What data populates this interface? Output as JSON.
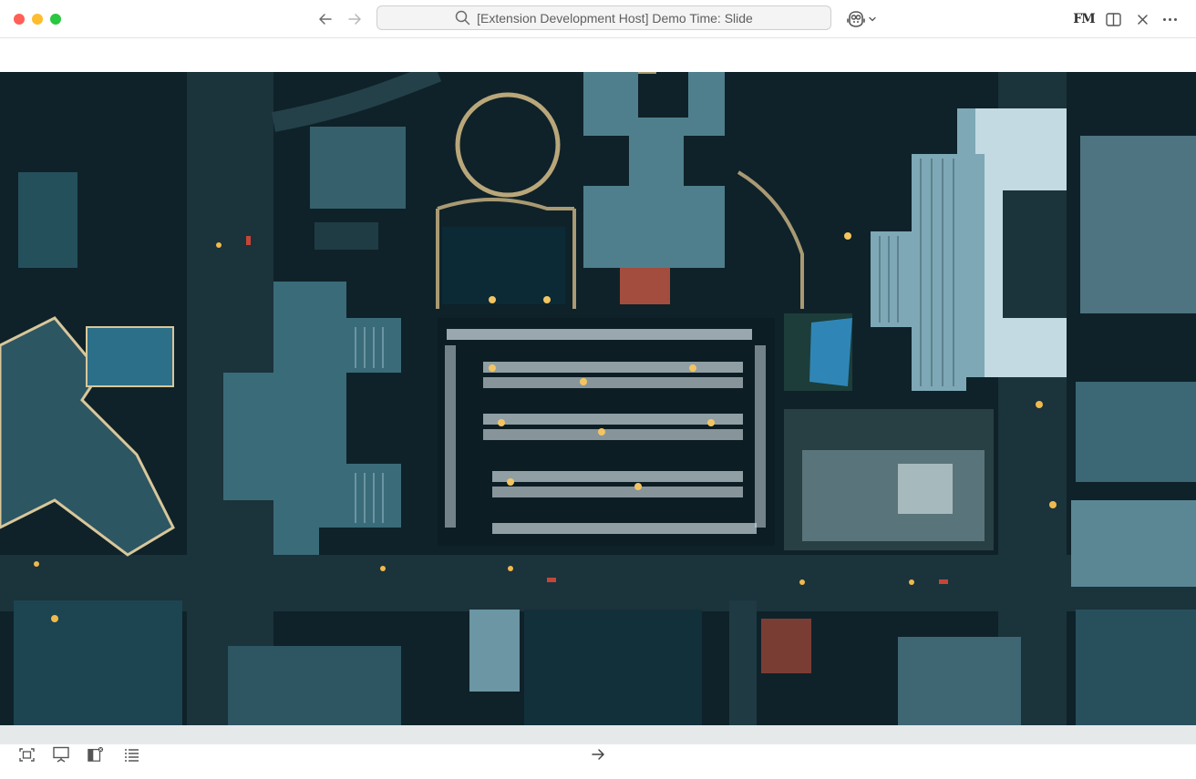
{
  "window": {
    "title": "[Extension Development Host] Demo Time: Slide"
  },
  "titlebar": {
    "traffic_lights": [
      "close",
      "minimize",
      "zoom"
    ],
    "nav": {
      "back_icon": "arrow-left-icon",
      "forward_icon": "arrow-right-icon"
    },
    "search_icon": "search-icon",
    "copilot_icon": "copilot-icon",
    "right_actions": [
      {
        "name": "fm-icon",
        "label": "FM"
      },
      {
        "name": "split-editor-icon"
      },
      {
        "name": "close-icon"
      },
      {
        "name": "more-actions-icon"
      }
    ]
  },
  "slide": {
    "image_description_icon": "slide-image",
    "colors": {
      "background": "#0f2229",
      "roads": "#1e3a44",
      "lights": "#f3c562"
    }
  },
  "bottombar": {
    "left_actions": [
      {
        "name": "fit-screen-icon"
      },
      {
        "name": "presentation-icon"
      },
      {
        "name": "panel-toggle-icon"
      },
      {
        "name": "list-icon"
      }
    ],
    "next_icon": "arrow-right-icon"
  }
}
